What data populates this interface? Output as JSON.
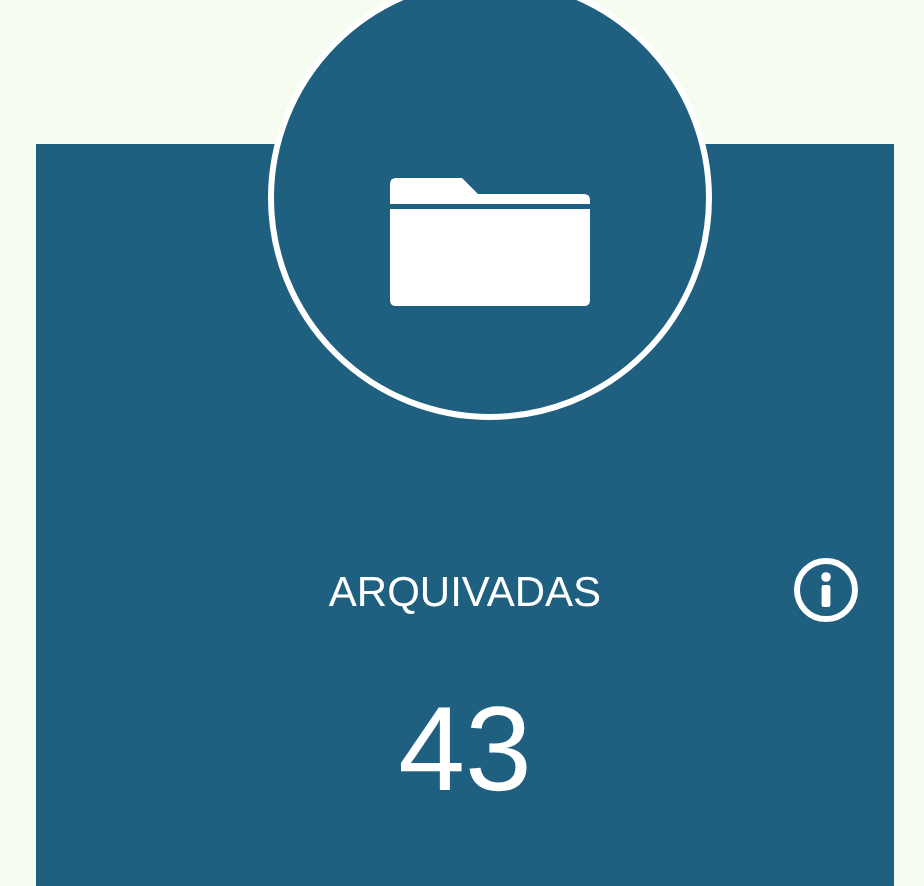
{
  "card": {
    "label": "ARQUIVADAS",
    "count": "43"
  }
}
